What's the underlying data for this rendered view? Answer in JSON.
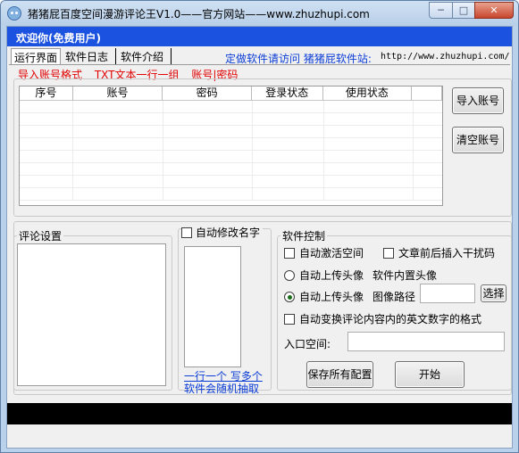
{
  "window": {
    "title": "猪猪屁百度空间漫游评论王V1.0——官方网站——www.zhuzhupi.com",
    "controls": {
      "minimize": "─",
      "maximize": "□",
      "close": "✕"
    },
    "icon": "pig-app-icon"
  },
  "header": {
    "welcome": "欢迎你(免费用户)"
  },
  "tabs": [
    {
      "label": "运行界面",
      "active": true
    },
    {
      "label": "软件日志",
      "active": false
    },
    {
      "label": "软件介绍",
      "active": false
    }
  ],
  "promo": {
    "label": "定做软件请访问  猪猪屁软件站:",
    "url": "http://www.zhuzhupi.com/"
  },
  "account_format": {
    "parts": [
      "导入账号格式",
      "TXT文本一行一组",
      "账号|密码"
    ],
    "color": "#e00000"
  },
  "accounts_table": {
    "columns": [
      "序号",
      "账号",
      "密码",
      "登录状态",
      "使用状态"
    ],
    "rows": []
  },
  "buttons": {
    "import": "导入账号",
    "clear": "清空账号",
    "choose": "选择",
    "save_all": "保存所有配置",
    "start": "开始"
  },
  "comment_settings": {
    "title": "评论设置",
    "text": ""
  },
  "auto_name": {
    "label": "自动修改名字",
    "checked": false,
    "hint_line1": "一行一个  写多个",
    "hint_line2": "软件会随机抽取"
  },
  "software_control": {
    "title": "软件控制",
    "auto_activate": {
      "label": "自动激活空间",
      "checked": false
    },
    "insert_noise": {
      "label": "文章前后插入干扰码",
      "checked": false
    },
    "avatar_builtin": {
      "label": "自动上传头像",
      "suffix": "软件内置头像",
      "selected": false
    },
    "avatar_path": {
      "label": "自动上传头像",
      "suffix": "图像路径",
      "selected": true,
      "value": ""
    },
    "convert_format": {
      "label": "自动变换评论内容内的英文数字的格式",
      "checked": false
    },
    "entry_space": {
      "label": "入口空间:",
      "value": ""
    }
  },
  "colors": {
    "welcome_bar": "#1c52e0",
    "link_blue": "#0a3cd6",
    "status_bar": "#000000"
  }
}
